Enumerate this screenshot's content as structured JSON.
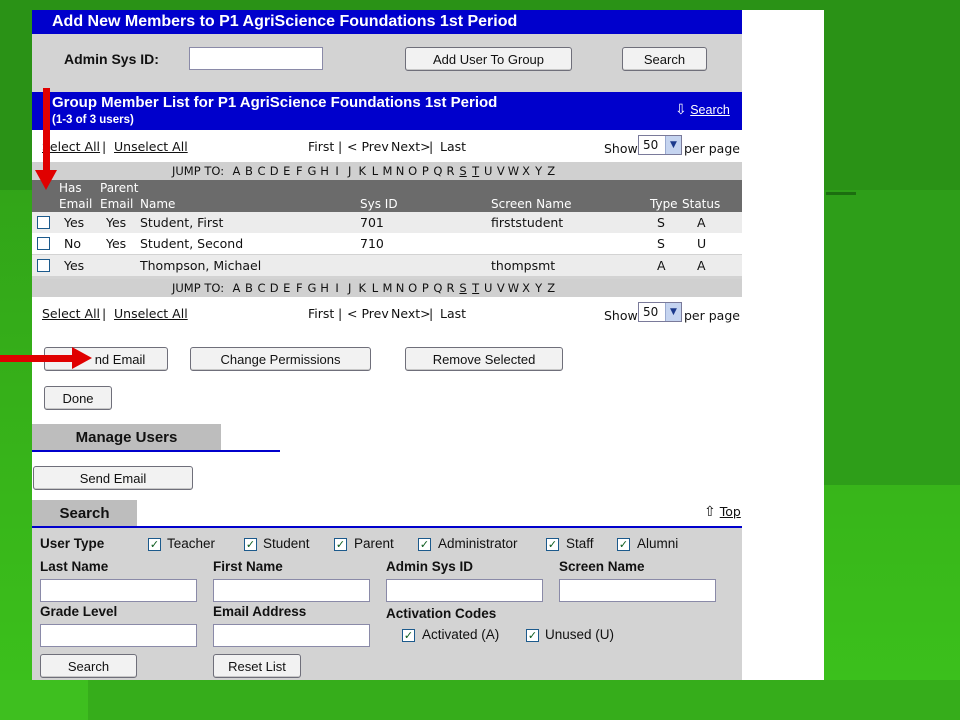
{
  "add_header": {
    "title": "Add New Members to P1 AgriScience Foundations 1st Period"
  },
  "add_form": {
    "admin_sys_id_label": "Admin Sys ID:",
    "admin_sys_id_value": "",
    "add_user_button": "Add User To Group",
    "search_button": "Search"
  },
  "group_header": {
    "title": "Group Member List for P1 AgriScience Foundations 1st Period",
    "subtitle": "(1-3 of 3 users)",
    "search_link": "Search"
  },
  "pager": {
    "select_all": "Select All",
    "separator": "|",
    "unselect_all": "Unselect All",
    "first": "First",
    "prev": "< Prev",
    "next": "Next>",
    "last": "Last",
    "show_label": "Show",
    "show_value": "50",
    "per_page": "per page"
  },
  "jump": {
    "label": "JUMP TO:",
    "letters": [
      "A",
      "B",
      "C",
      "D",
      "E",
      "F",
      "G",
      "H",
      "I",
      "J",
      "K",
      "L",
      "M",
      "N",
      "O",
      "P",
      "Q",
      "R",
      "S",
      "T",
      "U",
      "V",
      "W",
      "X",
      "Y",
      "Z"
    ],
    "underlined": [
      "S",
      "T"
    ]
  },
  "columns": {
    "has_email_top": "Has",
    "has_email_bottom": "Email",
    "parent_email_top": "Parent",
    "parent_email_bottom": "Email",
    "name": "Name",
    "sys_id": "Sys ID",
    "screen_name": "Screen Name",
    "type": "Type",
    "status": "Status"
  },
  "members": [
    {
      "has_email": "Yes",
      "parent_email": "Yes",
      "name": "Student, First",
      "sys_id": "701",
      "screen_name": "firststudent",
      "type": "S",
      "status": "A"
    },
    {
      "has_email": "No",
      "parent_email": "Yes",
      "name": "Student, Second",
      "sys_id": "710",
      "screen_name": "",
      "type": "S",
      "status": "U"
    },
    {
      "has_email": "Yes",
      "parent_email": "",
      "name": "Thompson, Michael",
      "sys_id": "",
      "screen_name": "thompsmt",
      "type": "A",
      "status": "A"
    }
  ],
  "actions": {
    "send_email_partial": "nd Email",
    "change_permissions": "Change Permissions",
    "remove_selected": "Remove Selected",
    "done": "Done"
  },
  "manage": {
    "title": "Manage Users",
    "send_email": "Send Email"
  },
  "search_panel": {
    "title": "Search",
    "top_link": "Top",
    "user_type_label": "User Type",
    "user_types": [
      "Teacher",
      "Student",
      "Parent",
      "Administrator",
      "Staff",
      "Alumni"
    ],
    "last_name_label": "Last Name",
    "first_name_label": "First Name",
    "admin_sys_id_label": "Admin Sys ID",
    "screen_name_label": "Screen Name",
    "grade_level_label": "Grade Level",
    "email_address_label": "Email Address",
    "activation_codes_label": "Activation Codes",
    "activated_label": "Activated (A)",
    "unused_label": "Unused (U)",
    "search_button": "Search",
    "reset_button": "Reset List"
  },
  "colors": {
    "header_blue": "#0000cc",
    "column_header_gray": "#6b6b6b",
    "panel_gray": "#d3d3d3",
    "annotation_red": "#e00000",
    "slide_green": "#36b019"
  },
  "annotations": [
    "red-arrow-down",
    "red-arrow-right"
  ]
}
